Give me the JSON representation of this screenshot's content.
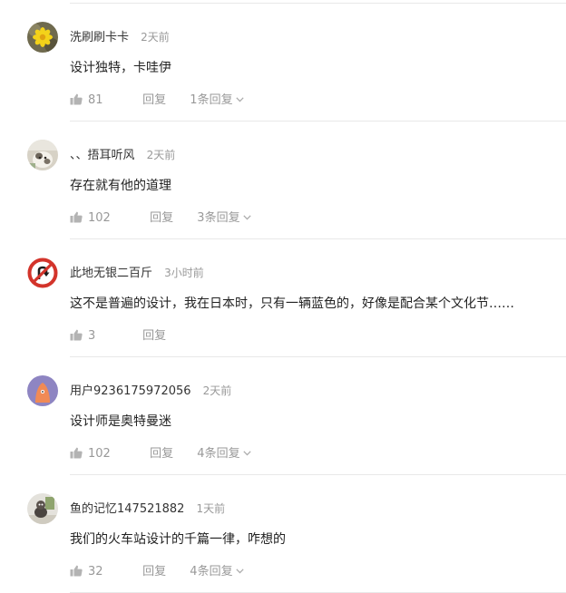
{
  "comments": [
    {
      "username": "洗刷刷卡卡",
      "time": "2天前",
      "text": "设计独特，卡哇伊",
      "likes": "81",
      "reply_label": "回复",
      "replies_label": "1条回复"
    },
    {
      "username": "、、捂耳听风",
      "time": "2天前",
      "text": "存在就有他的道理",
      "likes": "102",
      "reply_label": "回复",
      "replies_label": "3条回复"
    },
    {
      "username": "此地无银二百斤",
      "time": "3小时前",
      "text": "这不是普遍的设计，我在日本时，只有一辆蓝色的，好像是配合某个文化节……",
      "likes": "3",
      "reply_label": "回复"
    },
    {
      "username": "用户9236175972056",
      "time": "2天前",
      "text": "设计师是奥特曼迷",
      "likes": "102",
      "reply_label": "回复",
      "replies_label": "4条回复"
    },
    {
      "username": "鱼的记忆147521882",
      "time": "1天前",
      "text": "我们的火车站设计的千篇一律，咋想的",
      "likes": "32",
      "reply_label": "回复",
      "replies_label": "4条回复"
    }
  ],
  "colors": {
    "text_primary": "#222222",
    "text_secondary": "#999999",
    "divider": "#e8e8e8",
    "avatar_purple": "#8e85c2",
    "avatar_sign_red": "#d3342b"
  }
}
